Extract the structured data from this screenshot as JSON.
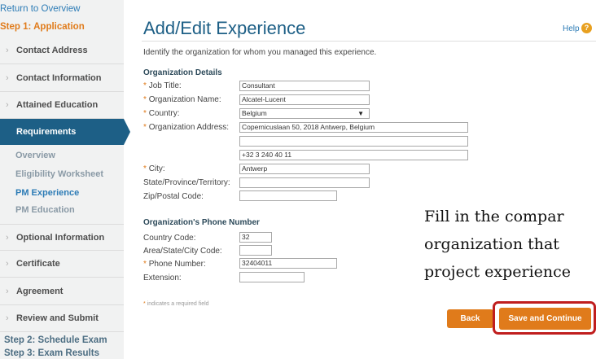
{
  "sidebar": {
    "return_link": "Return to Overview",
    "step1": "Step 1: Application",
    "items": {
      "contact_address": "Contact Address",
      "contact_information": "Contact Information",
      "attained_education": "Attained Education",
      "requirements": "Requirements",
      "optional_information": "Optional Information",
      "certificate": "Certificate",
      "agreement": "Agreement",
      "review_submit": "Review and Submit"
    },
    "subitems": {
      "overview": "Overview",
      "eligibility": "Eligibility Worksheet",
      "pm_experience": "PM Experience",
      "pm_education": "PM Education"
    },
    "step2": "Step 2: Schedule Exam",
    "step3": "Step 3: Exam Results"
  },
  "header": {
    "title": "Add/Edit Experience",
    "help": "Help",
    "help_icon": "?",
    "intro": "Identify the organization for whom you managed this experience."
  },
  "org": {
    "section": "Organization Details",
    "job_title_label": "Job Title:",
    "job_title_value": "Consultant",
    "org_name_label": "Organization Name:",
    "org_name_value": "Alcatel-Lucent",
    "country_label": "Country:",
    "country_value": "Belgium",
    "address_label": "Organization Address:",
    "address_line1": "Copernicuslaan 50, 2018 Antwerp, Belgium",
    "address_line2": "",
    "address_line3": "+32 3 240 40 11",
    "city_label": "City:",
    "city_value": "Antwerp",
    "state_label": "State/Province/Territory:",
    "state_value": "",
    "zip_label": "Zip/Postal Code:",
    "zip_value": ""
  },
  "phone": {
    "section": "Organization's Phone Number",
    "country_code_label": "Country Code:",
    "country_code_value": "32",
    "area_label": "Area/State/City Code:",
    "area_value": "",
    "number_label": "Phone Number:",
    "number_value": "32404011",
    "ext_label": "Extension:",
    "ext_value": ""
  },
  "required_star": "*",
  "required_note": "indicates a required field",
  "instruction": {
    "line1": "Fill in the compar",
    "line2": "organization that",
    "line3": "project experience"
  },
  "buttons": {
    "back": "Back",
    "save": "Save and Continue"
  },
  "colors": {
    "accent": "#e07b1b",
    "nav_active": "#1d5f86",
    "highlight": "#c01e1e"
  }
}
